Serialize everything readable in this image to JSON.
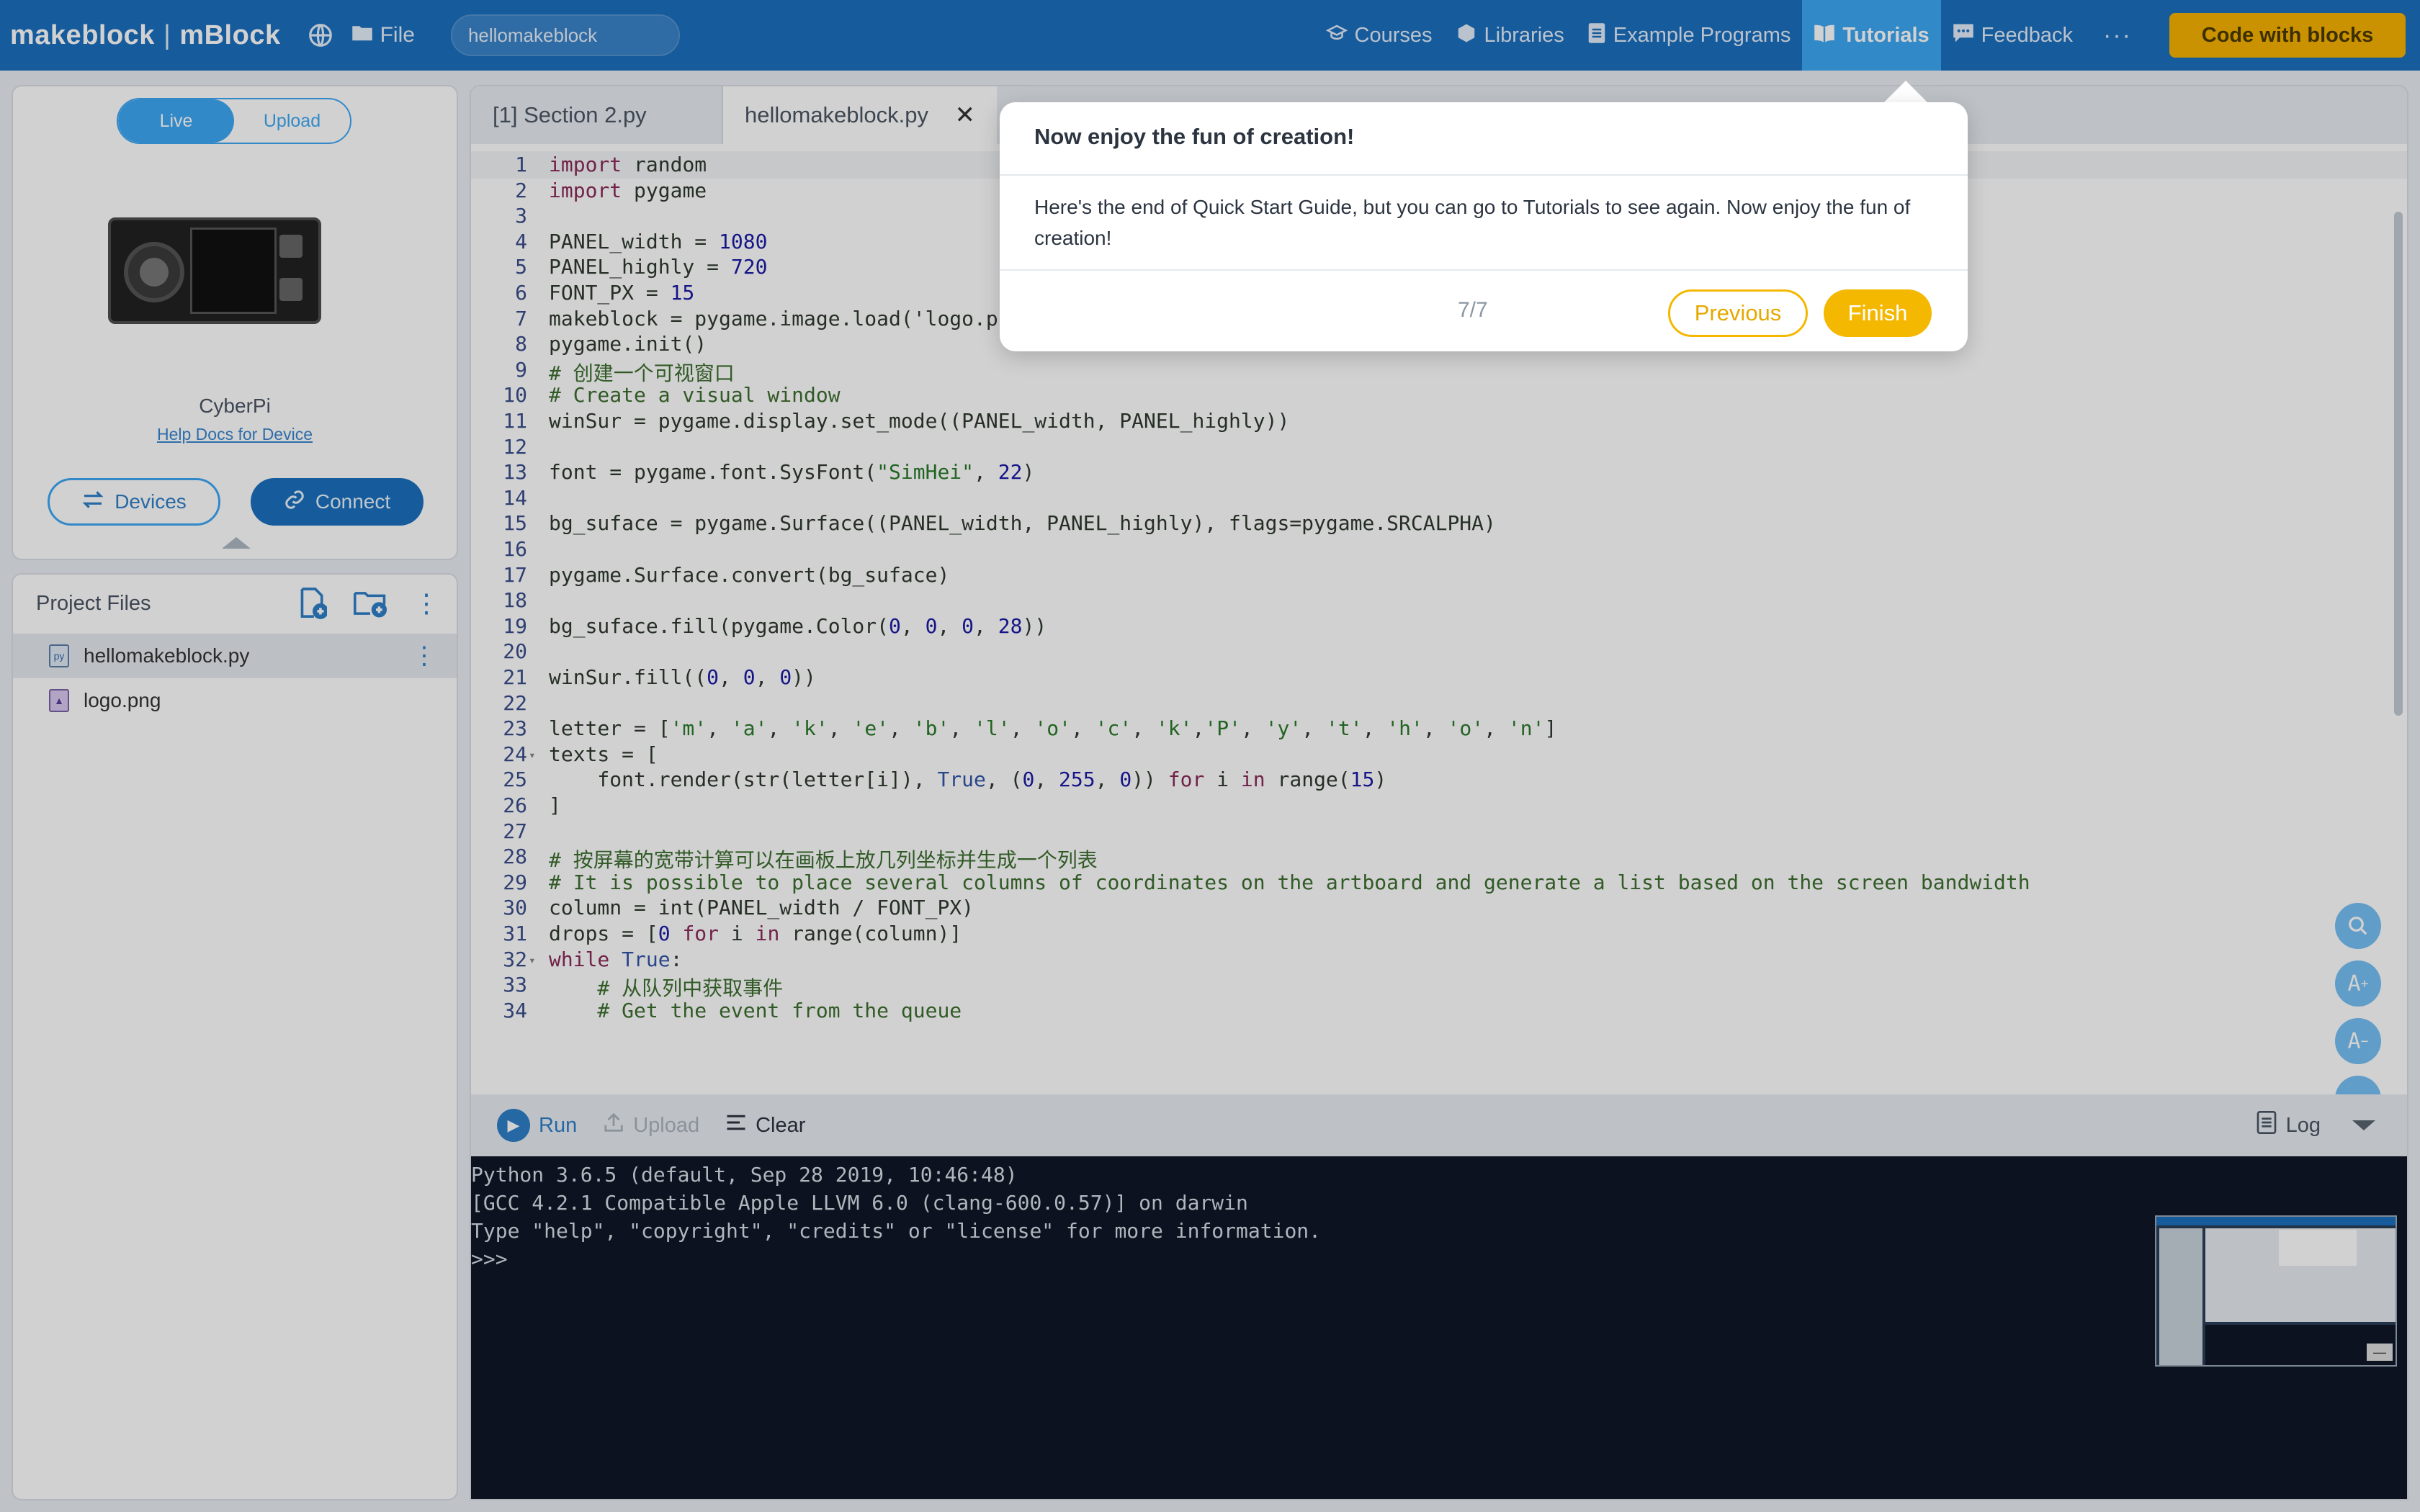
{
  "topbar": {
    "brand": "makeblock",
    "brand_sep": "|",
    "product": "mBlock",
    "file_label": "File",
    "project_name": "hellomakeblock",
    "nav": [
      {
        "label": "Courses",
        "icon": "graduation-cap-icon"
      },
      {
        "label": "Libraries",
        "icon": "cube-icon"
      },
      {
        "label": "Example Programs",
        "icon": "document-icon"
      },
      {
        "label": "Tutorials",
        "icon": "book-icon",
        "active": true
      },
      {
        "label": "Feedback",
        "icon": "chat-icon"
      }
    ],
    "more_label": "···",
    "code_with_blocks": "Code with blocks"
  },
  "device": {
    "mode_live": "Live",
    "mode_upload": "Upload",
    "name": "CyberPi",
    "help_docs": "Help Docs for Device",
    "devices_btn": "Devices",
    "connect_btn": "Connect"
  },
  "files": {
    "title": "Project Files",
    "items": [
      {
        "name": "hellomakeblock.py",
        "type": "py",
        "selected": true
      },
      {
        "name": "logo.png",
        "type": "png"
      }
    ]
  },
  "editor": {
    "tabs": [
      {
        "label": "[1] Section 2.py"
      },
      {
        "label": "hellomakeblock.py",
        "active": true
      }
    ],
    "close_glyph": "✕",
    "lines": [
      "import random",
      "import pygame",
      "",
      "PANEL_width = 1080",
      "PANEL_highly = 720",
      "FONT_PX = 15",
      "makeblock = pygame.image.load('logo.p",
      "pygame.init()",
      "# 创建一个可视窗口",
      "# Create a visual window",
      "winSur = pygame.display.set_mode((PANEL_width, PANEL_highly))",
      "",
      "font = pygame.font.SysFont(\"SimHei\", 22)",
      "",
      "bg_suface = pygame.Surface((PANEL_width, PANEL_highly), flags=pygame.SRCALPHA)",
      "",
      "pygame.Surface.convert(bg_suface)",
      "",
      "bg_suface.fill(pygame.Color(0, 0, 0, 28))",
      "",
      "winSur.fill((0, 0, 0))",
      "",
      "letter = ['m', 'a', 'k', 'e', 'b', 'l', 'o', 'c', 'k','P', 'y', 't', 'h', 'o', 'n']",
      "texts = [",
      "    font.render(str(letter[i]), True, (0, 255, 0)) for i in range(15)",
      "]",
      "",
      "# 按屏幕的宽带计算可以在画板上放几列坐标并生成一个列表",
      "# It is possible to place several columns of coordinates on the artboard and generate a list based on the screen bandwidth",
      "column = int(PANEL_width / FONT_PX)",
      "drops = [0 for i in range(column)]",
      "while True:",
      "    # 从队列中获取事件",
      "    # Get the event from the queue"
    ],
    "fold_lines": [
      24,
      32
    ]
  },
  "runbar": {
    "run": "Run",
    "upload": "Upload",
    "clear": "Clear",
    "log": "Log"
  },
  "console": {
    "lines": [
      "Python 3.6.5 (default, Sep 28 2019, 10:46:48)",
      "[GCC 4.2.1 Compatible Apple LLVM 6.0 (clang-600.0.57)] on darwin",
      "Type \"help\", \"copyright\", \"credits\" or \"license\" for more information.",
      ">>>"
    ]
  },
  "popup": {
    "title": "Now enjoy the fun of creation!",
    "body": "Here's the end of Quick Start Guide, but you can go to Tutorials to see again. Now enjoy the fun of creation!",
    "page": "7/7",
    "previous": "Previous",
    "finish": "Finish"
  },
  "colors": {
    "topbar": "#1c6fbf",
    "accent": "#3ea8f5",
    "brand_yellow": "#f5b800",
    "console_bg": "#0f1626"
  }
}
